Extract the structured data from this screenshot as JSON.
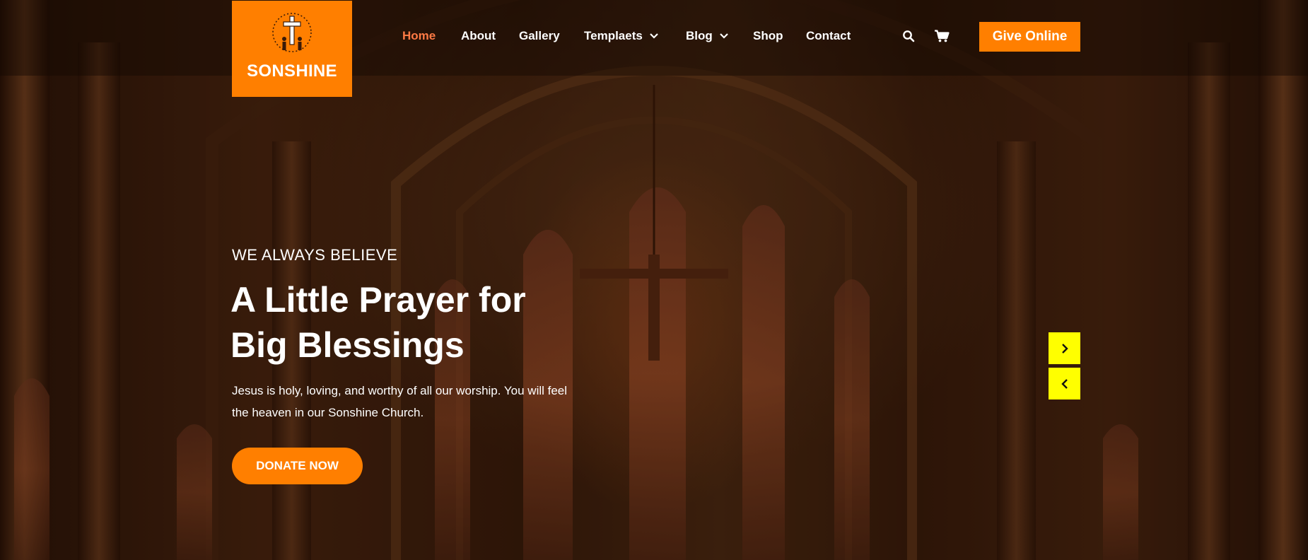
{
  "brand": {
    "name": "SONSHINE",
    "logo_icon": "cross-family-icon",
    "color": "#ff7f00"
  },
  "nav": {
    "items": [
      {
        "label": "Home",
        "active": true
      },
      {
        "label": "About"
      },
      {
        "label": "Gallery"
      },
      {
        "label": "Templaets",
        "dropdown": true
      },
      {
        "label": "Blog",
        "dropdown": true
      },
      {
        "label": "Shop"
      },
      {
        "label": "Contact"
      }
    ],
    "active_color": "#ff7a45",
    "search_icon": "search-icon",
    "cart_icon": "cart-icon",
    "give_button": "Give Online"
  },
  "hero": {
    "eyebrow": "WE ALWAYS BELIEVE",
    "headline_line1": "A Little Prayer for",
    "headline_line2": "Big Blessings",
    "description": "Jesus is holy, loving, and worthy of all our worship. You will feel the heaven in our Sonshine Church.",
    "cta": "DONATE NOW",
    "next_icon": "chevron-right-icon",
    "prev_icon": "chevron-left-icon",
    "arrow_color": "#ffff00"
  }
}
